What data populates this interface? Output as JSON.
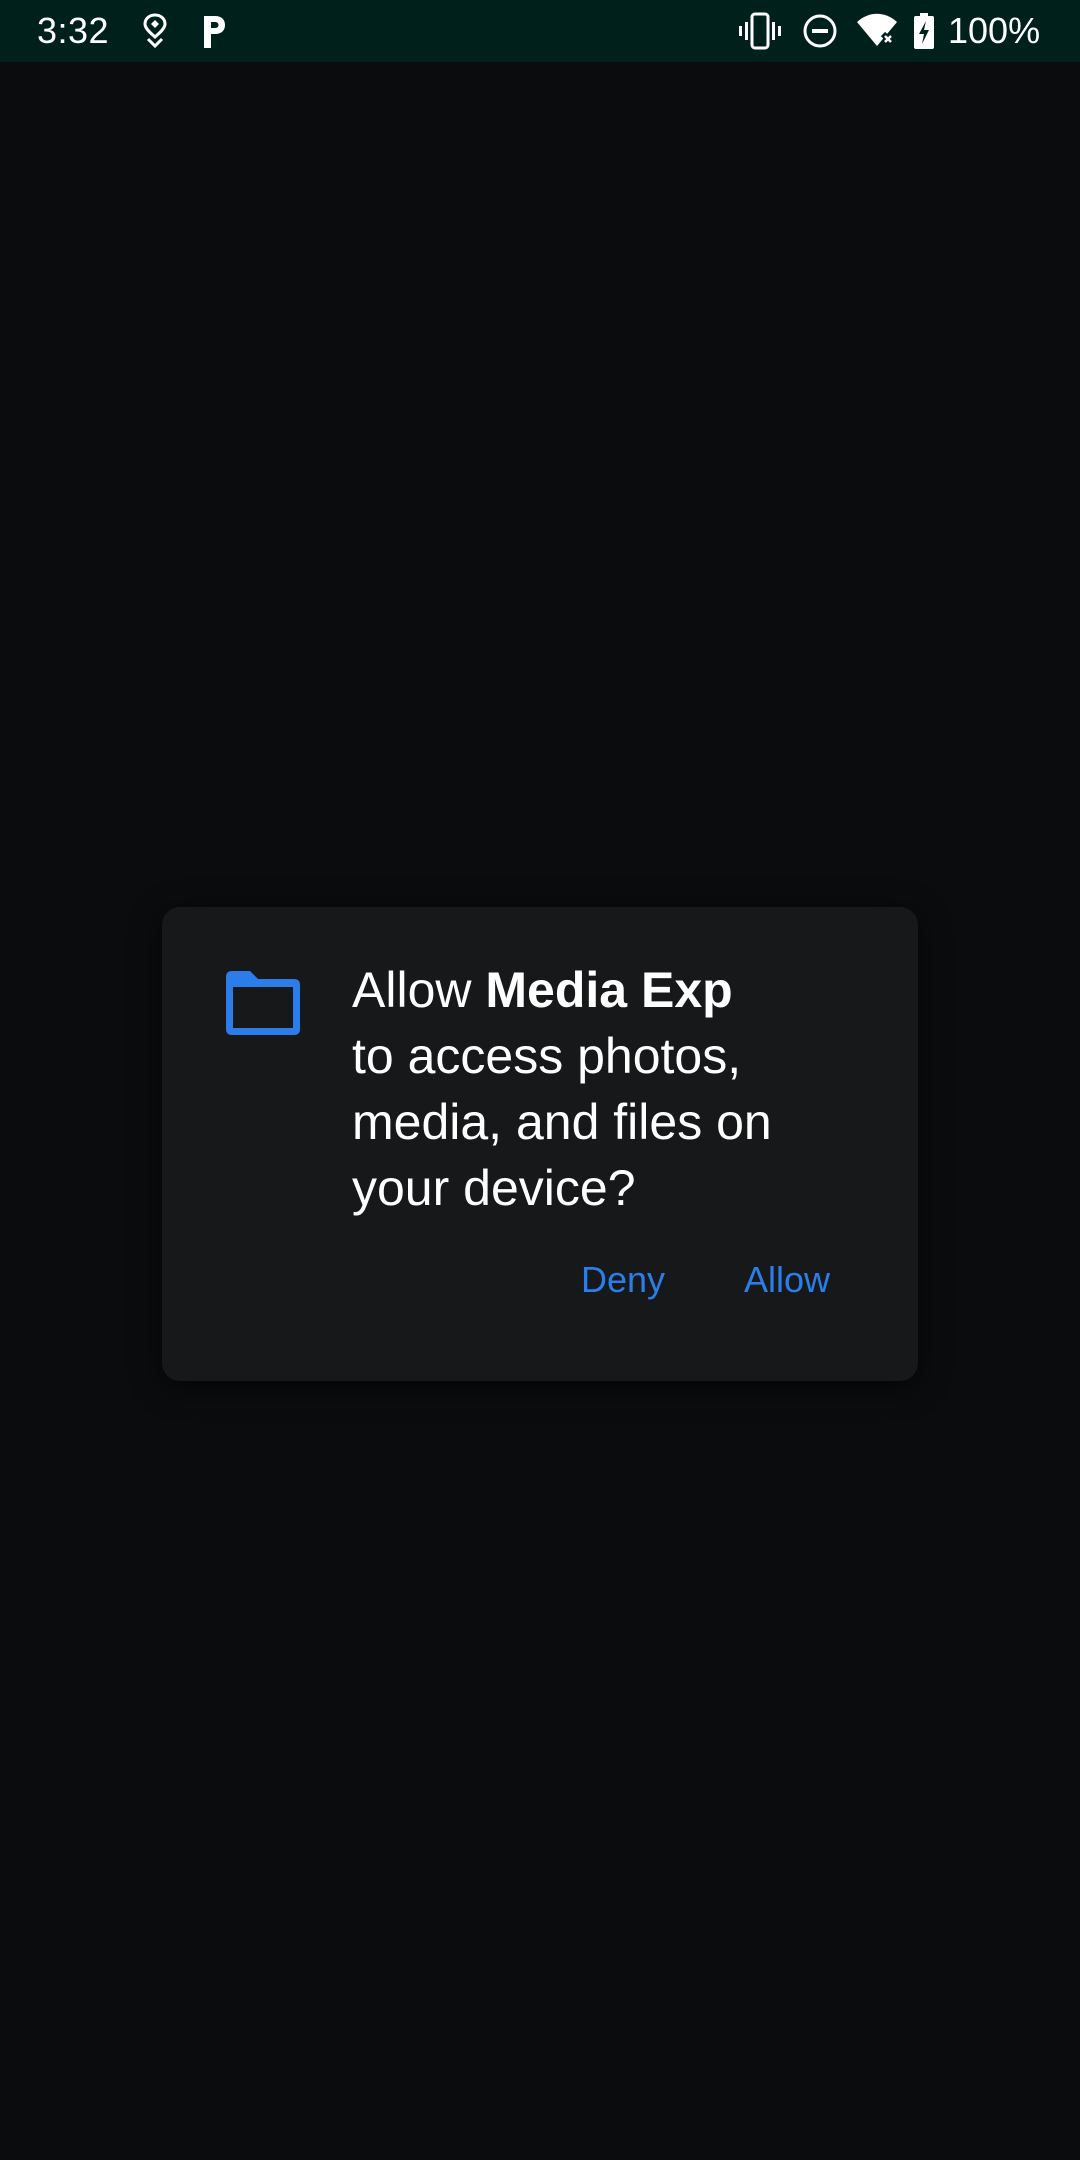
{
  "status_bar": {
    "time": "3:32",
    "battery": "100%",
    "icons": [
      "location-pin-icon",
      "parking-app-icon",
      "vibrate-icon",
      "do-not-disturb-icon",
      "wifi-no-internet-icon",
      "battery-charging-icon"
    ],
    "background_color": "#00201c"
  },
  "dialog": {
    "icon": "folder-icon",
    "message_prefix": "Allow ",
    "app_name": "Media Exp",
    "message_suffix": "to access photos, media, and files on your device?",
    "deny_label": "Deny",
    "allow_label": "Allow",
    "accent_color": "#2b7de9",
    "background_color": "#17181a"
  }
}
